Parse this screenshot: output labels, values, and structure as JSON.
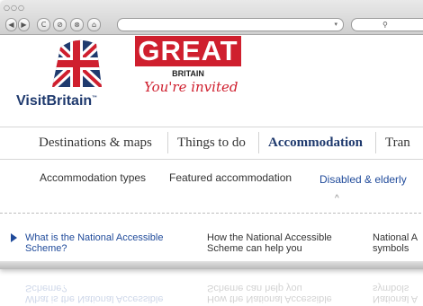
{
  "browser": {
    "traffic_lights": "○○○",
    "nav_buttons": {
      "back": "◀",
      "forward": "▶",
      "reload": "C",
      "stop": "⊘",
      "close": "⊗",
      "home": "⌂"
    },
    "address_dropdown": "▾",
    "search_glyph": "⚲"
  },
  "branding": {
    "visit_britain": "VisitBritain",
    "trademark": "™",
    "great": "GREAT",
    "britain": "BRITAIN",
    "tagline": "You're invited",
    "brand_color": "#cf1f2e",
    "navy_color": "#1f3a6e"
  },
  "main_nav": {
    "items": [
      "Destinations & maps",
      "Things to do",
      "Accommodation",
      "Tran"
    ],
    "active_index": 2
  },
  "sub_nav": {
    "items": [
      "Accommodation types",
      "Featured accommodation",
      "Disabled & elderly"
    ],
    "active_index": 2,
    "caret": "^"
  },
  "links": {
    "items": [
      {
        "line1": "What is the National Accessible",
        "line2": "Scheme?"
      },
      {
        "line1": "How the National Accessible",
        "line2": "Scheme can help you"
      },
      {
        "line1": "National A",
        "line2": "symbols"
      }
    ],
    "active_index": 0
  }
}
